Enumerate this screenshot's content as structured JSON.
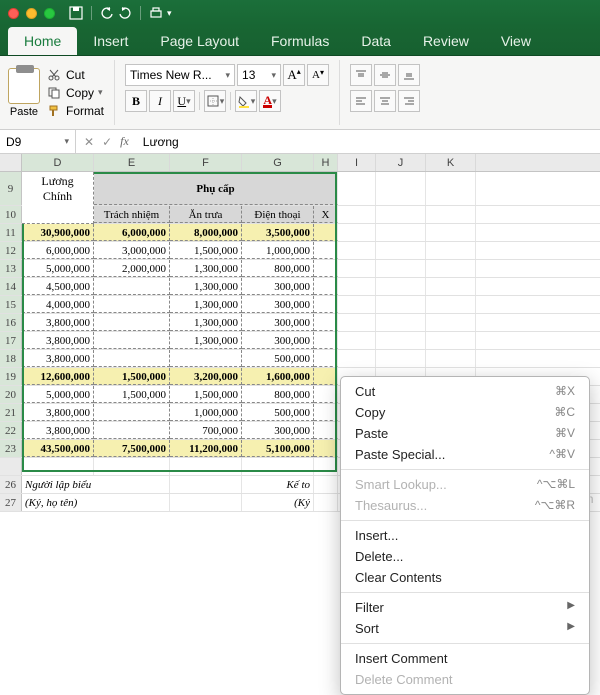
{
  "tabs": {
    "home": "Home",
    "insert": "Insert",
    "page": "Page Layout",
    "formulas": "Formulas",
    "data": "Data",
    "review": "Review",
    "view": "View"
  },
  "clip": {
    "paste": "Paste",
    "cut": "Cut",
    "copy": "Copy",
    "format": "Format"
  },
  "font": {
    "name": "Times New R...",
    "size": "13",
    "inc": "A",
    "dec": "A",
    "b": "B",
    "i": "I",
    "u": "U"
  },
  "fx": {
    "name": "D9",
    "label": "fx",
    "value": "Lương"
  },
  "cols": [
    "D",
    "E",
    "F",
    "G",
    "H",
    "I",
    "J",
    "K"
  ],
  "rows": [
    "9",
    "10",
    "11",
    "12",
    "13",
    "14",
    "15",
    "16",
    "17",
    "18",
    "19",
    "20",
    "21",
    "22",
    "23",
    "",
    "26",
    "27"
  ],
  "head": {
    "luong1": "Lương",
    "luong2": "Chính",
    "phucap": "Phụ cấp",
    "trach": "Trách nhiệm",
    "antrua": "Ăn trưa",
    "dienthoai": "Điện thoại",
    "x": "X"
  },
  "vals": [
    {
      "d": "30,900,000",
      "e": "6,000,000",
      "f": "8,000,000",
      "g": "3,500,000",
      "cls": "total"
    },
    {
      "d": "6,000,000",
      "e": "3,000,000",
      "f": "1,500,000",
      "g": "1,000,000",
      "cls": ""
    },
    {
      "d": "5,000,000",
      "e": "2,000,000",
      "f": "1,300,000",
      "g": "800,000",
      "cls": ""
    },
    {
      "d": "4,500,000",
      "e": "",
      "f": "1,300,000",
      "g": "300,000",
      "cls": ""
    },
    {
      "d": "4,000,000",
      "e": "",
      "f": "1,300,000",
      "g": "300,000",
      "cls": ""
    },
    {
      "d": "3,800,000",
      "e": "",
      "f": "1,300,000",
      "g": "300,000",
      "cls": ""
    },
    {
      "d": "3,800,000",
      "e": "",
      "f": "1,300,000",
      "g": "300,000",
      "cls": ""
    },
    {
      "d": "3,800,000",
      "e": "",
      "f": "",
      "g": "500,000",
      "cls": ""
    },
    {
      "d": "12,600,000",
      "e": "1,500,000",
      "f": "3,200,000",
      "g": "1,600,000",
      "cls": "total"
    },
    {
      "d": "5,000,000",
      "e": "1,500,000",
      "f": "1,500,000",
      "g": "800,000",
      "cls": ""
    },
    {
      "d": "3,800,000",
      "e": "",
      "f": "1,000,000",
      "g": "500,000",
      "cls": ""
    },
    {
      "d": "3,800,000",
      "e": "",
      "f": "700,000",
      "g": "300,000",
      "cls": ""
    },
    {
      "d": "43,500,000",
      "e": "7,500,000",
      "f": "11,200,000",
      "g": "5,100,000",
      "cls": "total"
    }
  ],
  "foot": {
    "nguoi": "Người lập biểu",
    "ky": "(Ký, họ tên)",
    "ke": "Kế to",
    "ky2": "(Ký"
  },
  "ctx": {
    "cut": "Cut",
    "cutk": "⌘X",
    "copy": "Copy",
    "copyk": "⌘C",
    "paste": "Paste",
    "pastek": "⌘V",
    "ps": "Paste Special...",
    "psk": "^⌘V",
    "sl": "Smart Lookup...",
    "slk": "^⌥⌘L",
    "th": "Thesaurus...",
    "thk": "^⌥⌘R",
    "ins": "Insert...",
    "del": "Delete...",
    "clr": "Clear Contents",
    "filter": "Filter",
    "sort": "Sort",
    "ic": "Insert Comment",
    "dc": "Delete Comment"
  },
  "watermark": "thuthuattienich.com"
}
